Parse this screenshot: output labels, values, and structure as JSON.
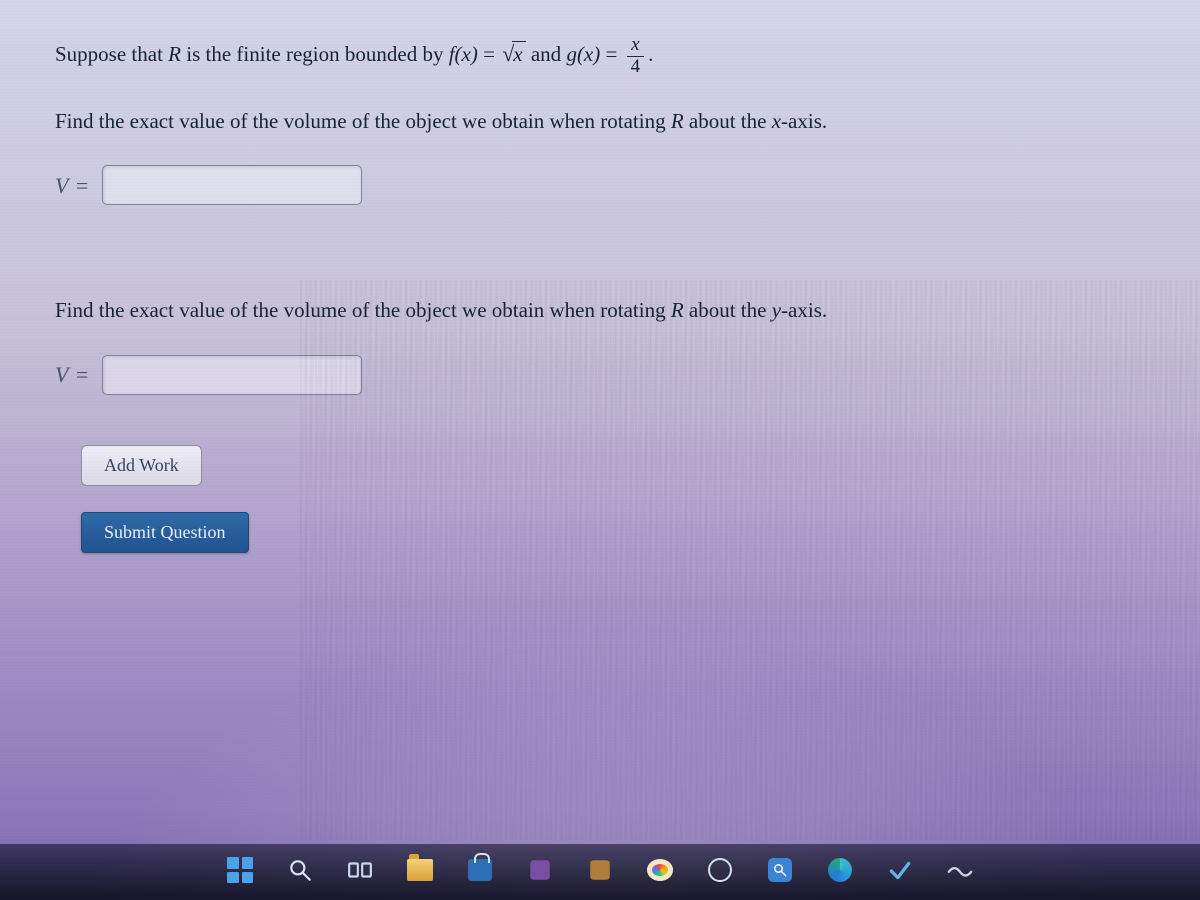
{
  "problem": {
    "intro_prefix": "Suppose that ",
    "region_var": "R",
    "intro_mid": " is the finite region bounded by ",
    "f_label": "f(x)",
    "eq1": " = ",
    "sqrt_radicand": "x",
    "and_word": " and ",
    "g_label": "g(x)",
    "eq2": " = ",
    "frac_num": "x",
    "frac_den": "4",
    "period": "."
  },
  "part1": {
    "prompt_prefix": "Find the exact value of the volume of the object we obtain when rotating ",
    "region_var": "R",
    "prompt_suffix": " about the ",
    "axis": "x",
    "axis_suffix": "-axis.",
    "label": "V =",
    "value": ""
  },
  "part2": {
    "prompt_prefix": "Find the exact value of the volume of the object we obtain when rotating ",
    "region_var": "R",
    "prompt_suffix": " about the ",
    "axis": "y",
    "axis_suffix": "-axis.",
    "label": "V =",
    "value": ""
  },
  "buttons": {
    "add_work": "Add Work",
    "submit": "Submit Question"
  },
  "taskbar": {
    "start": "Start",
    "search": "Search",
    "task_view": "Task View",
    "file_explorer": "File Explorer",
    "store": "Microsoft Store",
    "app1": "App",
    "app2": "App",
    "paint": "Paint",
    "circle": "Cortana",
    "zoom": "Magnifier",
    "edge": "Microsoft Edge",
    "check": "Task complete",
    "wave": "Notifications"
  }
}
